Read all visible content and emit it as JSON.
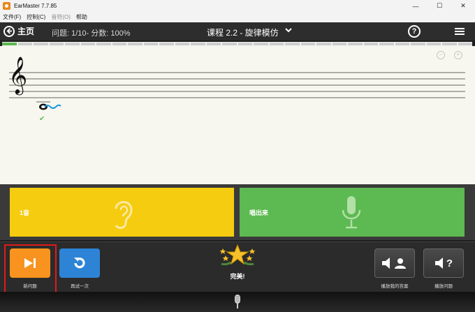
{
  "window": {
    "title": "EarMaster 7.7.85",
    "controls": {
      "minimize": "—",
      "maximize": "☐",
      "close": "✕"
    }
  },
  "menu": [
    {
      "label": "文件(F)",
      "enabled": true
    },
    {
      "label": "控制(C)",
      "enabled": true
    },
    {
      "label": "音符(O)",
      "enabled": false
    },
    {
      "label": "帮助",
      "enabled": true
    }
  ],
  "toolbar": {
    "home_label": "主页",
    "question_info": "问题: 1/10- 分数: 100%",
    "lesson_title": "课程 2.2 - 旋律模仿",
    "help_glyph": "?"
  },
  "progress": {
    "completed": 1,
    "total": 10
  },
  "answer_cards": {
    "listen": {
      "label": "1音",
      "color": "#f5cc0f"
    },
    "sing": {
      "label": "唱出来",
      "color": "#5db951"
    }
  },
  "buttons": {
    "new_question": {
      "label": "新问题",
      "color": "#f7931e"
    },
    "retry": {
      "label": "再试一次",
      "color": "#2d84d6"
    },
    "play_my_answer": {
      "label": "播放我的答案"
    },
    "play_question": {
      "label": "播放问题",
      "glyph": "?"
    }
  },
  "status": {
    "text": "完美!"
  },
  "colors": {
    "progress_done": "#5dba4f",
    "correct_check": "#5dba4f",
    "highlight": "#e21b1b"
  }
}
